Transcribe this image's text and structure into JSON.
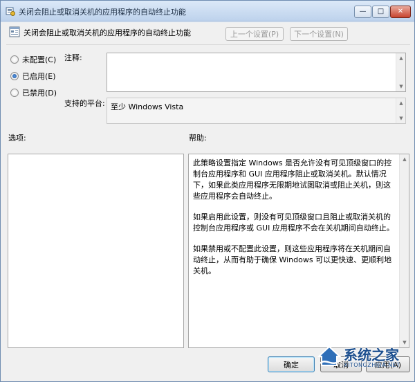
{
  "window": {
    "title": "关闭会阻止或取消关机的应用程序的自动终止功能",
    "min_glyph": "—",
    "max_glyph": "□",
    "close_glyph": "✕"
  },
  "header": {
    "policy_name": "关闭会阻止或取消关机的应用程序的自动终止功能",
    "prev_label": "上一个设置(P)",
    "next_label": "下一个设置(N)"
  },
  "state": {
    "options": [
      {
        "label": "未配置(C)",
        "checked": false
      },
      {
        "label": "已启用(E)",
        "checked": true
      },
      {
        "label": "已禁用(D)",
        "checked": false
      }
    ]
  },
  "comment": {
    "label": "注释:",
    "value": ""
  },
  "platform": {
    "label": "支持的平台:",
    "value": "至少 Windows Vista"
  },
  "options_panel": {
    "label": "选项:"
  },
  "help": {
    "label": "帮助:",
    "paragraphs": [
      "此策略设置指定 Windows 是否允许没有可见顶级窗口的控制台应用程序和 GUI 应用程序阻止或取消关机。默认情况下，如果此类应用程序无限期地试图取消或阻止关机，则这些应用程序会自动终止。",
      "如果启用此设置，则没有可见顶级窗口且阻止或取消关机的控制台应用程序或 GUI 应用程序不会在关机期间自动终止。",
      "如果禁用或不配置此设置，则这些应用程序将在关机期间自动终止，从而有助于确保 Windows 可以更快速、更顺利地关机。"
    ]
  },
  "buttons": {
    "ok": "确定",
    "cancel": "取消",
    "apply": "应用(A)"
  },
  "watermark": {
    "text": "系统之家",
    "sub": "XITONGZHIJIA.NET"
  },
  "colors": {
    "title_gradient_top": "#dce9f8",
    "title_gradient_bottom": "#bdd2ec",
    "close_red": "#c8442f",
    "radio_blue": "#1b4f96",
    "watermark_blue": "#1c4f8f"
  }
}
